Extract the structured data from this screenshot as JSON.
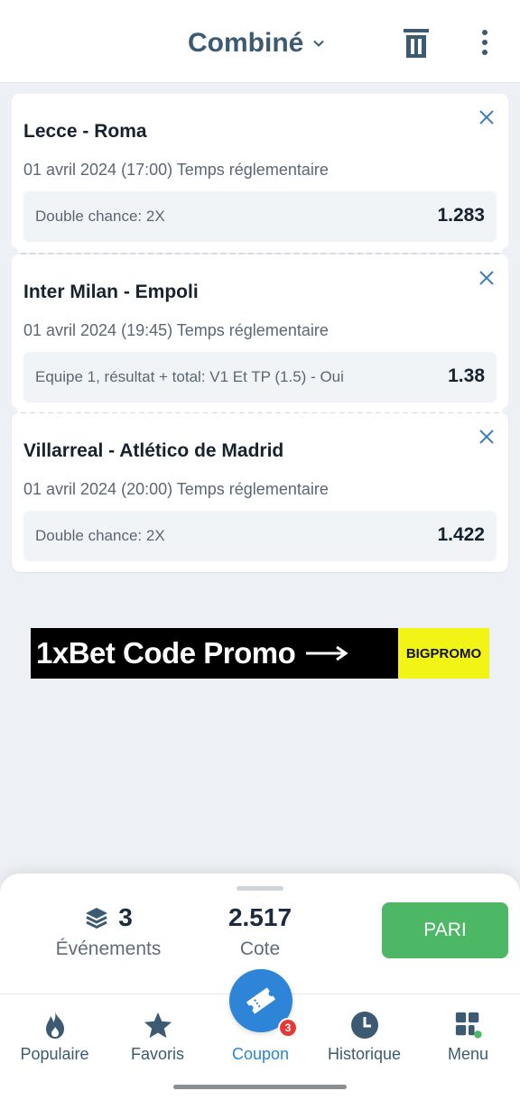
{
  "header": {
    "title": "Combiné",
    "icons": {
      "dropdown": "chevron-down-icon",
      "delete": "trash-icon",
      "more": "more-vertical-icon"
    }
  },
  "bets": [
    {
      "match": "Lecce - Roma",
      "date": "01 avril 2024 (17:00) Temps réglementaire",
      "market": "Double chance: 2X",
      "odd": "1.283"
    },
    {
      "match": "Inter Milan - Empoli",
      "date": "01 avril 2024 (19:45) Temps réglementaire",
      "market": "Equipe 1, résultat + total: V1 Et TP (1.5) - Oui",
      "odd": "1.38"
    },
    {
      "match": "Villarreal - Atlético de Madrid",
      "date": "01 avril 2024 (20:00) Temps réglementaire",
      "market": "Double chance: 2X",
      "odd": "1.422"
    }
  ],
  "banner": {
    "text": "1xBet Code Promo",
    "code": "BIGPROMO"
  },
  "summary": {
    "events_count": "3",
    "events_label": "Événements",
    "odds_value": "2.517",
    "odds_label": "Cote",
    "bet_button": "PARI"
  },
  "navbar": {
    "items": [
      {
        "label": "Populaire",
        "icon": "flame-icon"
      },
      {
        "label": "Favoris",
        "icon": "star-icon"
      },
      {
        "label": "Coupon",
        "icon": "ticket-icon",
        "badge": "3"
      },
      {
        "label": "Historique",
        "icon": "clock-icon"
      },
      {
        "label": "Menu",
        "icon": "grid-icon"
      }
    ]
  },
  "colors": {
    "accent_blue": "#2e84d6",
    "bet_green": "#4cb866",
    "banner_yellow": "#f2f416",
    "text_blue": "#3c5a72"
  }
}
